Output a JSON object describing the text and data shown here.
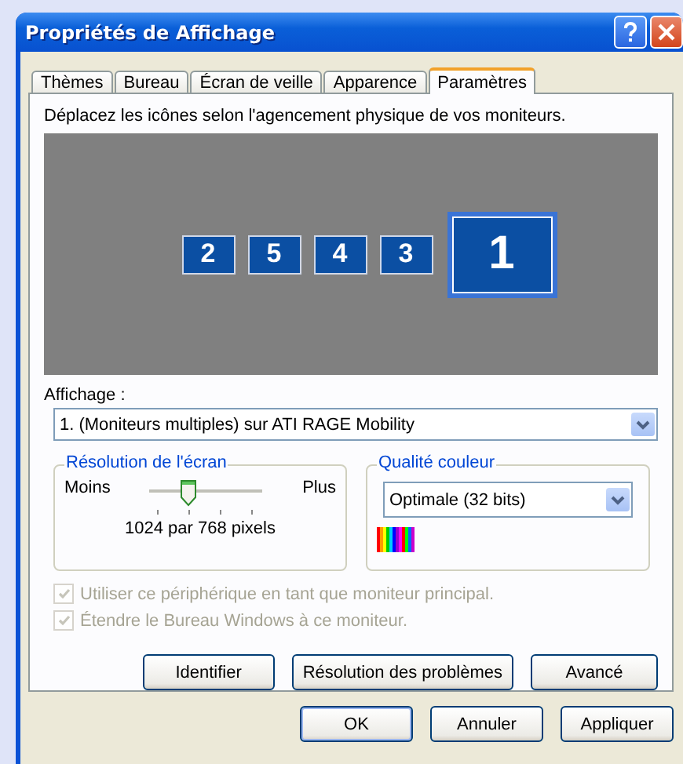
{
  "window": {
    "title": "Propriétés de Affichage"
  },
  "tabs": [
    {
      "label": "Thèmes",
      "selected": false
    },
    {
      "label": "Bureau",
      "selected": false
    },
    {
      "label": "Écran de veille",
      "selected": false
    },
    {
      "label": "Apparence",
      "selected": false
    },
    {
      "label": "Paramètres",
      "selected": true
    }
  ],
  "instructions": "Déplacez les icônes selon l'agencement physique de vos moniteurs.",
  "monitors": [
    {
      "label": "2",
      "selected": false
    },
    {
      "label": "5",
      "selected": false
    },
    {
      "label": "4",
      "selected": false
    },
    {
      "label": "3",
      "selected": false
    },
    {
      "label": "1",
      "selected": true
    }
  ],
  "display": {
    "label": "Affichage :",
    "value": "1. (Moniteurs multiples) sur ATI RAGE Mobility"
  },
  "resolution": {
    "title": "Résolution de l'écran",
    "min_label": "Moins",
    "max_label": "Plus",
    "level": 0.33,
    "reading": "1024 par 768 pixels"
  },
  "color_quality": {
    "title": "Qualité couleur",
    "value": "Optimale (32 bits)"
  },
  "options": [
    {
      "label": "Utiliser ce périphérique en tant que moniteur principal.",
      "checked": true,
      "disabled": true
    },
    {
      "label": "Étendre le Bureau Windows à ce moniteur.",
      "checked": true,
      "disabled": true
    }
  ],
  "panel_buttons": [
    "Identifier",
    "Résolution des problèmes",
    "Avancé"
  ],
  "dialog_buttons": [
    {
      "label": "OK",
      "default": true
    },
    {
      "label": "Annuler",
      "default": false
    },
    {
      "label": "Appliquer",
      "default": false
    }
  ]
}
